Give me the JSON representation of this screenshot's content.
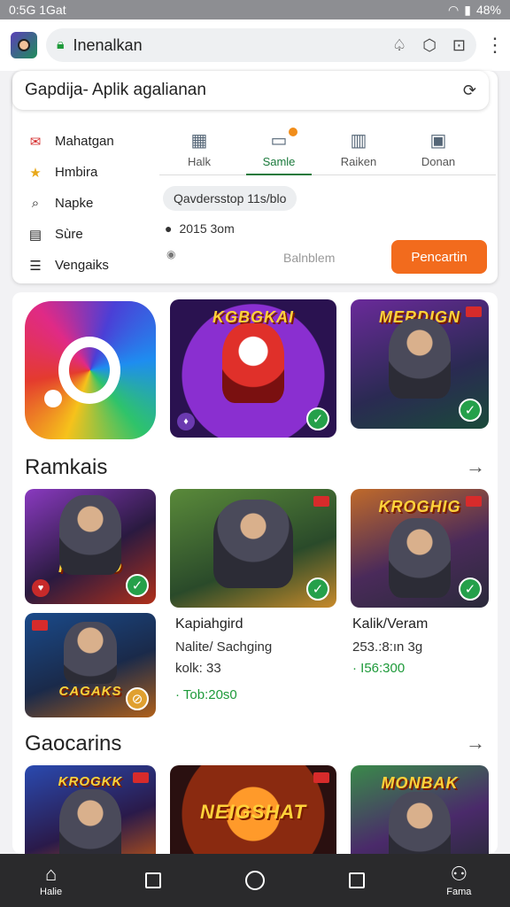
{
  "status": {
    "time": "0:5G 1Gat",
    "battery": "48%"
  },
  "browser": {
    "url": "Inenalkan"
  },
  "search": {
    "value": "Gapdija- Aplik agalianan"
  },
  "menu": [
    {
      "icon": "mail-icon",
      "glyph": "✉",
      "label": "Mahatgan",
      "color": "#d42a2a"
    },
    {
      "icon": "star-icon",
      "glyph": "★",
      "label": "Hmbira",
      "color": "#e8a81a"
    },
    {
      "icon": "search-icon",
      "glyph": "⌕",
      "label": "Napke",
      "color": "#555555"
    },
    {
      "icon": "book-icon",
      "glyph": "▤",
      "label": "Sùre",
      "color": "#555555"
    },
    {
      "icon": "list-icon",
      "glyph": "☰",
      "label": "Vengaiks",
      "color": "#555555"
    }
  ],
  "tabs": [
    {
      "label": "Halk",
      "glyph": "▦",
      "active": false
    },
    {
      "label": "Samle",
      "glyph": "▭",
      "active": true
    },
    {
      "label": "Raiken",
      "glyph": "▥",
      "active": false
    },
    {
      "label": "Donan",
      "glyph": "▣",
      "active": false
    }
  ],
  "chip": "Qavdersstop 11s/blo",
  "time": "2015 3om",
  "mid_text": "Balnblem",
  "cta": "Pencartin",
  "top_tiles": [
    {
      "title": "KGBGKAI"
    },
    {
      "title": "MERDIGN"
    }
  ],
  "section1": {
    "title": "Ramkais"
  },
  "grid_tiles": [
    {
      "title": "KUNGO"
    },
    {
      "title": ""
    },
    {
      "title": "KROGHIG"
    },
    {
      "title": "CAGAKS"
    }
  ],
  "app1": {
    "name": "Kapiahgird",
    "sub": "Nalite/ Sachging",
    "meta": "kolk: 33",
    "price": "· Tob:20s0"
  },
  "app2": {
    "name": "Kalik/Veram",
    "sub": "253.:8:ın 3g",
    "price": "· I56:300"
  },
  "section2": {
    "title": "Gaocarins"
  },
  "bottom_tiles": [
    {
      "title": "KROGKK"
    },
    {
      "title": "NEIGSHAT"
    },
    {
      "title": "MONBAK"
    }
  ],
  "nav": [
    {
      "label": "Halie",
      "icon": "home-icon"
    },
    {
      "label": "",
      "icon": "square-icon"
    },
    {
      "label": "",
      "icon": "circle-icon"
    },
    {
      "label": "",
      "icon": "square-icon"
    },
    {
      "label": "Fama",
      "icon": "person-icon"
    }
  ]
}
